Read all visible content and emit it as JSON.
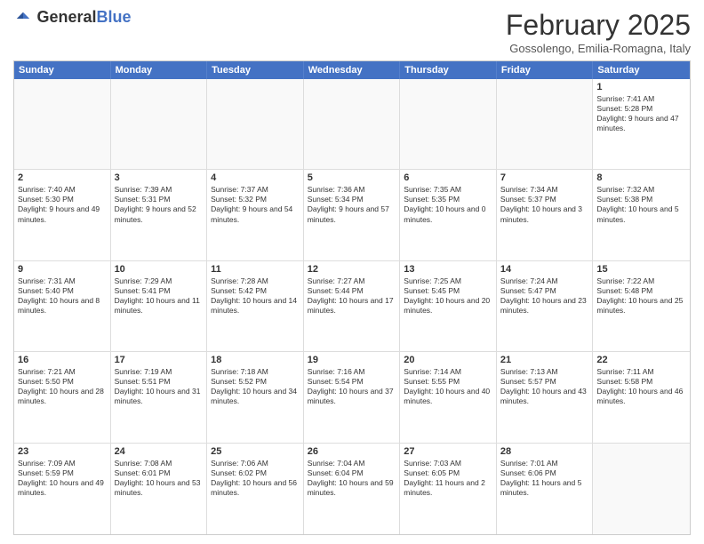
{
  "logo": {
    "line1": "General",
    "line2": "Blue"
  },
  "title": "February 2025",
  "location": "Gossolengo, Emilia-Romagna, Italy",
  "header_days": [
    "Sunday",
    "Monday",
    "Tuesday",
    "Wednesday",
    "Thursday",
    "Friday",
    "Saturday"
  ],
  "weeks": [
    [
      {
        "day": "",
        "text": "",
        "empty": true
      },
      {
        "day": "",
        "text": "",
        "empty": true
      },
      {
        "day": "",
        "text": "",
        "empty": true
      },
      {
        "day": "",
        "text": "",
        "empty": true
      },
      {
        "day": "",
        "text": "",
        "empty": true
      },
      {
        "day": "",
        "text": "",
        "empty": true
      },
      {
        "day": "1",
        "text": "Sunrise: 7:41 AM\nSunset: 5:28 PM\nDaylight: 9 hours and 47 minutes.",
        "empty": false
      }
    ],
    [
      {
        "day": "2",
        "text": "Sunrise: 7:40 AM\nSunset: 5:30 PM\nDaylight: 9 hours and 49 minutes.",
        "empty": false
      },
      {
        "day": "3",
        "text": "Sunrise: 7:39 AM\nSunset: 5:31 PM\nDaylight: 9 hours and 52 minutes.",
        "empty": false
      },
      {
        "day": "4",
        "text": "Sunrise: 7:37 AM\nSunset: 5:32 PM\nDaylight: 9 hours and 54 minutes.",
        "empty": false
      },
      {
        "day": "5",
        "text": "Sunrise: 7:36 AM\nSunset: 5:34 PM\nDaylight: 9 hours and 57 minutes.",
        "empty": false
      },
      {
        "day": "6",
        "text": "Sunrise: 7:35 AM\nSunset: 5:35 PM\nDaylight: 10 hours and 0 minutes.",
        "empty": false
      },
      {
        "day": "7",
        "text": "Sunrise: 7:34 AM\nSunset: 5:37 PM\nDaylight: 10 hours and 3 minutes.",
        "empty": false
      },
      {
        "day": "8",
        "text": "Sunrise: 7:32 AM\nSunset: 5:38 PM\nDaylight: 10 hours and 5 minutes.",
        "empty": false
      }
    ],
    [
      {
        "day": "9",
        "text": "Sunrise: 7:31 AM\nSunset: 5:40 PM\nDaylight: 10 hours and 8 minutes.",
        "empty": false
      },
      {
        "day": "10",
        "text": "Sunrise: 7:29 AM\nSunset: 5:41 PM\nDaylight: 10 hours and 11 minutes.",
        "empty": false
      },
      {
        "day": "11",
        "text": "Sunrise: 7:28 AM\nSunset: 5:42 PM\nDaylight: 10 hours and 14 minutes.",
        "empty": false
      },
      {
        "day": "12",
        "text": "Sunrise: 7:27 AM\nSunset: 5:44 PM\nDaylight: 10 hours and 17 minutes.",
        "empty": false
      },
      {
        "day": "13",
        "text": "Sunrise: 7:25 AM\nSunset: 5:45 PM\nDaylight: 10 hours and 20 minutes.",
        "empty": false
      },
      {
        "day": "14",
        "text": "Sunrise: 7:24 AM\nSunset: 5:47 PM\nDaylight: 10 hours and 23 minutes.",
        "empty": false
      },
      {
        "day": "15",
        "text": "Sunrise: 7:22 AM\nSunset: 5:48 PM\nDaylight: 10 hours and 25 minutes.",
        "empty": false
      }
    ],
    [
      {
        "day": "16",
        "text": "Sunrise: 7:21 AM\nSunset: 5:50 PM\nDaylight: 10 hours and 28 minutes.",
        "empty": false
      },
      {
        "day": "17",
        "text": "Sunrise: 7:19 AM\nSunset: 5:51 PM\nDaylight: 10 hours and 31 minutes.",
        "empty": false
      },
      {
        "day": "18",
        "text": "Sunrise: 7:18 AM\nSunset: 5:52 PM\nDaylight: 10 hours and 34 minutes.",
        "empty": false
      },
      {
        "day": "19",
        "text": "Sunrise: 7:16 AM\nSunset: 5:54 PM\nDaylight: 10 hours and 37 minutes.",
        "empty": false
      },
      {
        "day": "20",
        "text": "Sunrise: 7:14 AM\nSunset: 5:55 PM\nDaylight: 10 hours and 40 minutes.",
        "empty": false
      },
      {
        "day": "21",
        "text": "Sunrise: 7:13 AM\nSunset: 5:57 PM\nDaylight: 10 hours and 43 minutes.",
        "empty": false
      },
      {
        "day": "22",
        "text": "Sunrise: 7:11 AM\nSunset: 5:58 PM\nDaylight: 10 hours and 46 minutes.",
        "empty": false
      }
    ],
    [
      {
        "day": "23",
        "text": "Sunrise: 7:09 AM\nSunset: 5:59 PM\nDaylight: 10 hours and 49 minutes.",
        "empty": false
      },
      {
        "day": "24",
        "text": "Sunrise: 7:08 AM\nSunset: 6:01 PM\nDaylight: 10 hours and 53 minutes.",
        "empty": false
      },
      {
        "day": "25",
        "text": "Sunrise: 7:06 AM\nSunset: 6:02 PM\nDaylight: 10 hours and 56 minutes.",
        "empty": false
      },
      {
        "day": "26",
        "text": "Sunrise: 7:04 AM\nSunset: 6:04 PM\nDaylight: 10 hours and 59 minutes.",
        "empty": false
      },
      {
        "day": "27",
        "text": "Sunrise: 7:03 AM\nSunset: 6:05 PM\nDaylight: 11 hours and 2 minutes.",
        "empty": false
      },
      {
        "day": "28",
        "text": "Sunrise: 7:01 AM\nSunset: 6:06 PM\nDaylight: 11 hours and 5 minutes.",
        "empty": false
      },
      {
        "day": "",
        "text": "",
        "empty": true
      }
    ]
  ]
}
